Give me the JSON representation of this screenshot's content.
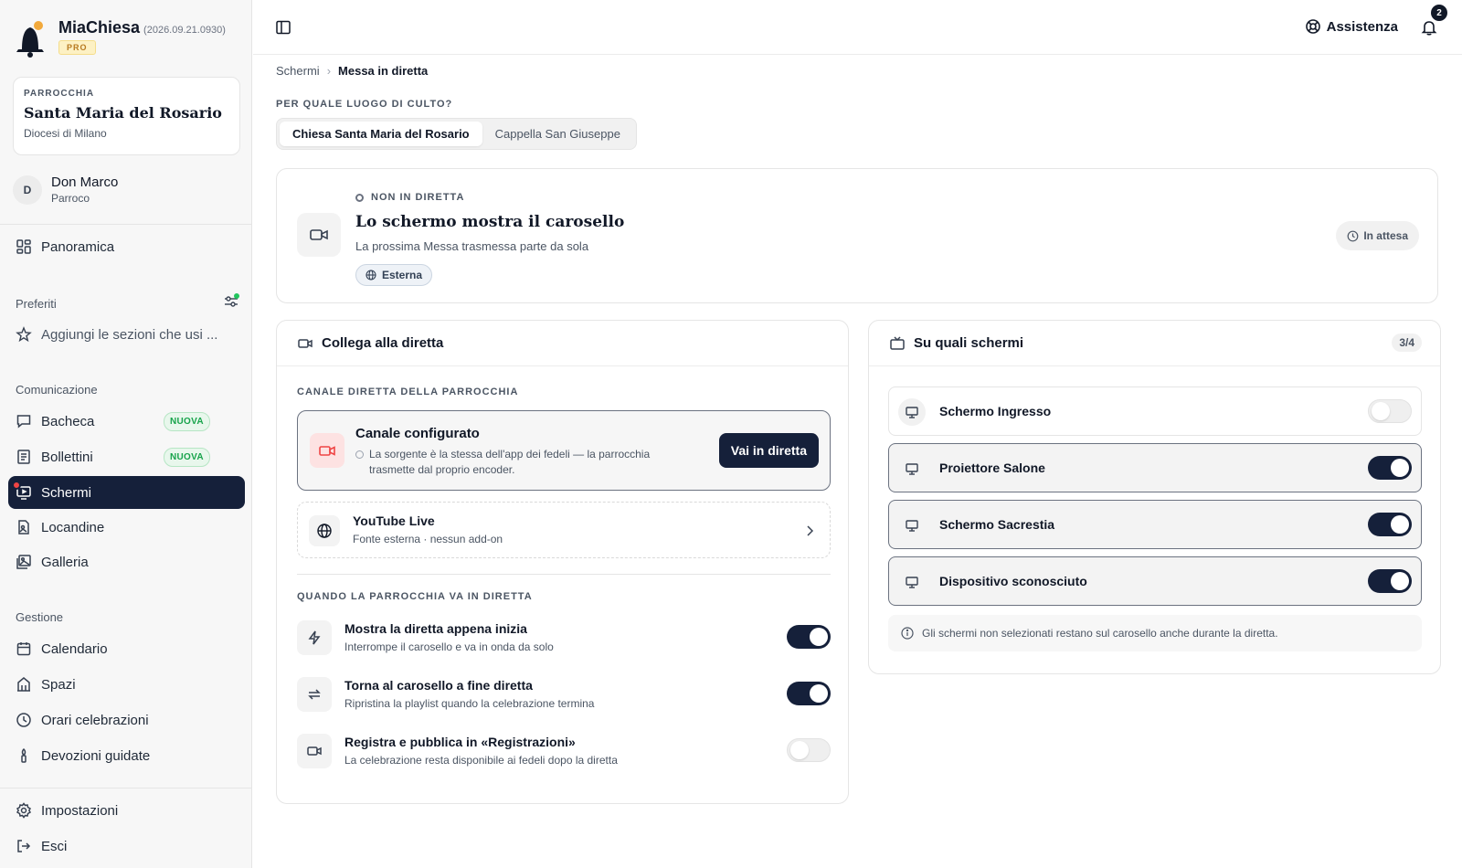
{
  "brand": {
    "name": "MiaChiesa",
    "version": "(2026.09.21.0930)",
    "plan": "PRO"
  },
  "parish": {
    "label": "PARROCCHIA",
    "name": "Santa Maria del Rosario",
    "diocese": "Diocesi di Milano"
  },
  "user": {
    "initial": "D",
    "name": "Don Marco",
    "role": "Parroco"
  },
  "nav": {
    "overview": "Panoramica",
    "favorites_title": "Preferiti",
    "favorites_hint": "Aggiungi le sezioni che usi ...",
    "comm_title": "Comunicazione",
    "comm": [
      {
        "label": "Bacheca",
        "badge": "NUOVA"
      },
      {
        "label": "Bollettini",
        "badge": "NUOVA"
      },
      {
        "label": "Schermi"
      },
      {
        "label": "Locandine"
      },
      {
        "label": "Galleria"
      }
    ],
    "mgmt_title": "Gestione",
    "mgmt": [
      {
        "label": "Calendario"
      },
      {
        "label": "Spazi"
      },
      {
        "label": "Orari celebrazioni"
      },
      {
        "label": "Devozioni guidate"
      }
    ],
    "settings": "Impostazioni",
    "logout": "Esci"
  },
  "topbar": {
    "help": "Assistenza",
    "notifications": "2"
  },
  "breadcrumb": {
    "parent": "Schermi",
    "current": "Messa in diretta"
  },
  "venue": {
    "question": "PER QUALE LUOGO DI CULTO?",
    "options": [
      "Chiesa Santa Maria del Rosario",
      "Cappella San Giuseppe"
    ],
    "selected": "Chiesa Santa Maria del Rosario"
  },
  "status": {
    "kicker": "NON IN DIRETTA",
    "title": "Lo schermo mostra il carosello",
    "subtitle": "La prossima Messa trasmessa parte da sola",
    "source_chip": "Esterna",
    "state": "In attesa"
  },
  "connect": {
    "title": "Collega alla diretta",
    "channel_label": "CANALE DIRETTA DELLA PARROCCHIA",
    "channel_title": "Canale configurato",
    "channel_desc": "La sorgente è la stessa dell'app dei fedeli — la parrocchia trasmette dal proprio encoder.",
    "go_live": "Vai in diretta",
    "yt_title": "YouTube Live",
    "yt_sub": "Fonte esterna · nessun add-on",
    "when_label": "QUANDO LA PARROCCHIA VA IN DIRETTA",
    "options": [
      {
        "title": "Mostra la diretta appena inizia",
        "sub": "Interrompe il carosello e va in onda da solo",
        "on": true
      },
      {
        "title": "Torna al carosello a fine diretta",
        "sub": "Ripristina la playlist quando la celebrazione termina",
        "on": true
      },
      {
        "title": "Registra e pubblica in «Registrazioni»",
        "sub": "La celebrazione resta disponibile ai fedeli dopo la diretta",
        "on": false
      }
    ]
  },
  "screens": {
    "title": "Su quali schermi",
    "count": "3/4",
    "items": [
      {
        "name": "Schermo Ingresso",
        "on": false
      },
      {
        "name": "Proiettore Salone",
        "on": true
      },
      {
        "name": "Schermo Sacrestia",
        "on": true
      },
      {
        "name": "Dispositivo sconosciuto",
        "on": true
      }
    ],
    "note": "Gli schermi non selezionati restano sul carosello anche durante la diretta."
  },
  "colors": {
    "primary": "#15203a",
    "accent_red": "#ef4444",
    "new_badge": "#16a34a",
    "pro_badge": "#b7791f"
  }
}
